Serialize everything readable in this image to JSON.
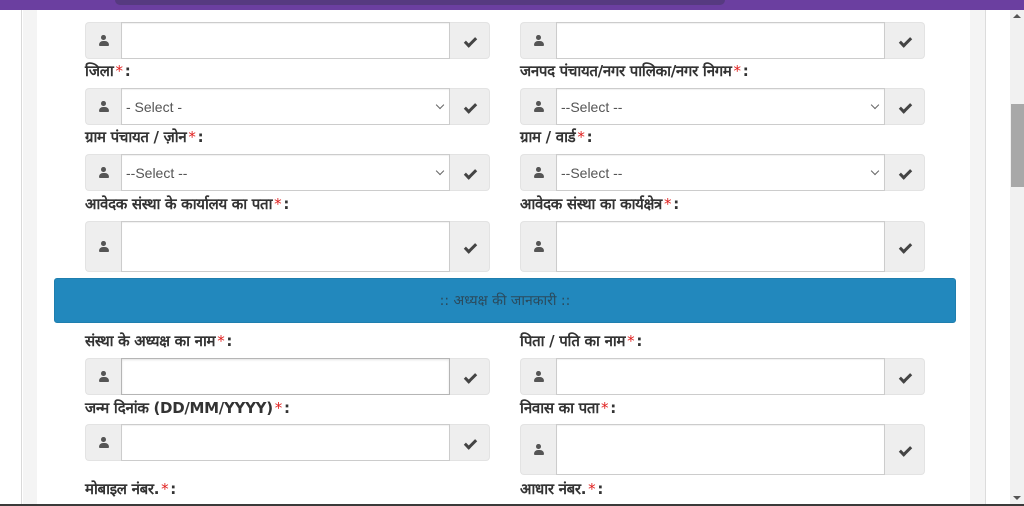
{
  "required_marker": "*",
  "label_suffix": ":",
  "top_row": {
    "left_input_value": "",
    "right_input_value": ""
  },
  "fields": {
    "district": {
      "label": "जिला",
      "value": "- Select -",
      "type": "select"
    },
    "janpad": {
      "label": "जनपद पंचायत/नगर पालिका/नगर निगम",
      "value": "--Select --",
      "type": "select"
    },
    "gram_panchayat": {
      "label": "ग्राम पंचायत / ज़ोन",
      "value": "--Select --",
      "type": "select"
    },
    "gram_ward": {
      "label": "ग्राम / वार्ड",
      "value": "--Select --",
      "type": "select"
    },
    "office_address": {
      "label": "आवेदक संस्था के कार्यालय का पता",
      "value": "",
      "type": "textarea"
    },
    "work_area": {
      "label": "आवेदक संस्था का कार्यक्षेत्र",
      "value": "",
      "type": "textarea"
    }
  },
  "section": {
    "title": ":: अध्यक्ष की जानकारी ::"
  },
  "president": {
    "name": {
      "label": "संस्था के अध्यक्ष का नाम",
      "value": ""
    },
    "father_husband": {
      "label": "पिता / पति का नाम",
      "value": ""
    },
    "dob": {
      "label": "जन्म दिनांक (DD/MM/YYYY)",
      "value": ""
    },
    "residence": {
      "label": "निवास का पता",
      "value": ""
    },
    "mobile": {
      "label": "मोबाइल नंबर."
    },
    "aadhar": {
      "label": "आधार नंबर."
    }
  },
  "icons": {
    "addon_left": "user-icon",
    "addon_right": "check-icon"
  },
  "colors": {
    "topbar": "#6b3fa0",
    "section_bar": "#2288bd",
    "required": "#e0201f",
    "addon_bg": "#eeeeee"
  }
}
